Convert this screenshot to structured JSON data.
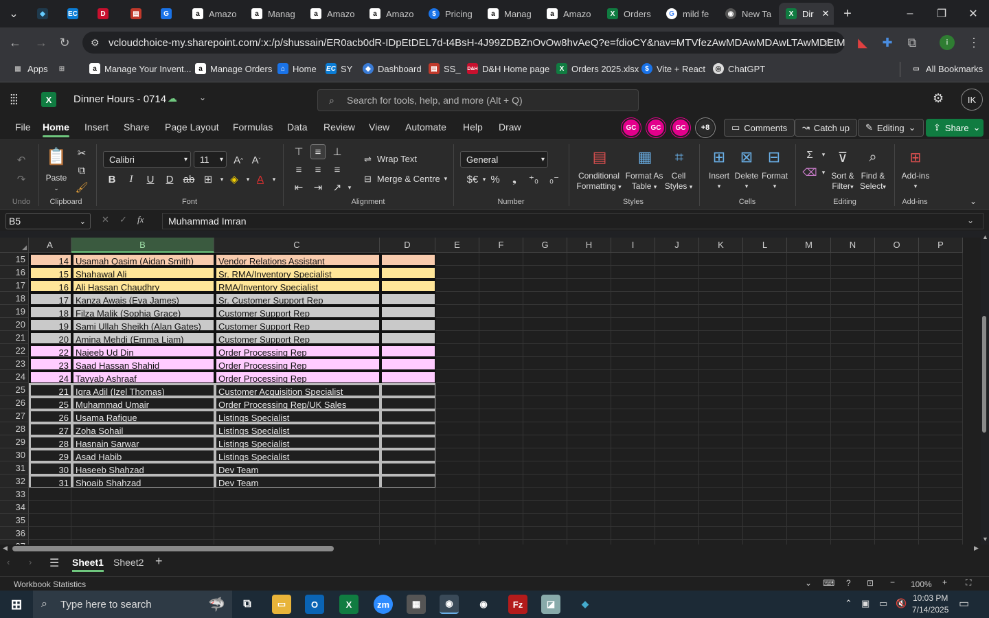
{
  "browser": {
    "tabs": [
      {
        "label": "",
        "icon": "app-icon",
        "active": false
      },
      {
        "label": "",
        "icon": "ec-icon",
        "active": false
      },
      {
        "label": "",
        "icon": "dh-icon",
        "active": false
      },
      {
        "label": "",
        "icon": "box-icon",
        "active": false
      },
      {
        "label": "",
        "icon": "g-icon",
        "active": false
      },
      {
        "label": "Amazo",
        "icon": "amazon-icon",
        "active": false
      },
      {
        "label": "Manag",
        "icon": "amazon-icon",
        "active": false
      },
      {
        "label": "Amazo",
        "icon": "amazon-icon",
        "active": false
      },
      {
        "label": "Amazo",
        "icon": "amazon-icon",
        "active": false
      },
      {
        "label": "Pricing",
        "icon": "dollar-icon",
        "active": false
      },
      {
        "label": "Manag",
        "icon": "amazon-icon",
        "active": false
      },
      {
        "label": "Amazo",
        "icon": "amazon-icon",
        "active": false
      },
      {
        "label": "Orders",
        "icon": "excel-icon",
        "active": false
      },
      {
        "label": "mild fe",
        "icon": "google-icon",
        "active": false
      },
      {
        "label": "New Ta",
        "icon": "chrome-icon",
        "active": false
      },
      {
        "label": "Dir",
        "icon": "excel-icon",
        "active": true
      }
    ],
    "url": "vcloudchoice-my.sharepoint.com/:x:/p/shussain/ER0acb0dR-IDpEtDEL7d-t4BsH-4J99ZDBZnOvOw8hvAeQ?e=fdioCY&nav=MTVfezAwMDAwMDAwLTAwMDEtMDAw...",
    "bookmarks": [
      {
        "label": "Apps"
      },
      {
        "label": ""
      },
      {
        "label": "Manage Your Invent..."
      },
      {
        "label": "Manage Orders"
      },
      {
        "label": "Home"
      },
      {
        "label": "SY"
      },
      {
        "label": "Dashboard"
      },
      {
        "label": "SS_"
      },
      {
        "label": "D&H Home page"
      },
      {
        "label": "Orders 2025.xlsx"
      },
      {
        "label": "Vite + React"
      },
      {
        "label": "ChatGPT"
      }
    ],
    "all_bookmarks": "All Bookmarks"
  },
  "excel": {
    "doc_title": "Dinner Hours - 0714",
    "search_placeholder": "Search for tools, help, and more (Alt + Q)",
    "user_initials": "IK",
    "menus": [
      "File",
      "Home",
      "Insert",
      "Share",
      "Page Layout",
      "Formulas",
      "Data",
      "Review",
      "View",
      "Automate",
      "Help",
      "Draw"
    ],
    "collaborators": [
      "GC",
      "GC",
      "GC"
    ],
    "collab_more": "+8",
    "comments_label": "Comments",
    "catchup_label": "Catch up",
    "editing_label": "Editing",
    "share_label": "Share",
    "ribbon": {
      "undo_group": "Undo",
      "paste": "Paste",
      "clipboard_group": "Clipboard",
      "font_name": "Calibri",
      "font_size": "11",
      "font_group": "Font",
      "wrap_text": "Wrap Text",
      "merge_centre": "Merge & Centre",
      "alignment_group": "Alignment",
      "number_format": "General",
      "number_group": "Number",
      "cond_format_1": "Conditional",
      "cond_format_2": "Formatting",
      "format_table_1": "Format As",
      "format_table_2": "Table",
      "cell_styles_1": "Cell",
      "cell_styles_2": "Styles",
      "styles_group": "Styles",
      "insert": "Insert",
      "delete": "Delete",
      "format": "Format",
      "cells_group": "Cells",
      "sort_1": "Sort &",
      "sort_2": "Filter",
      "find_1": "Find &",
      "find_2": "Select",
      "editing_group": "Editing",
      "addins": "Add-ins",
      "addins_group": "Add-ins"
    },
    "name_box": "B5",
    "formula": "Muhammad Imran",
    "columns": [
      "A",
      "B",
      "C",
      "D",
      "E",
      "F",
      "G",
      "H",
      "I",
      "J",
      "K",
      "L",
      "M",
      "N",
      "O",
      "P"
    ],
    "rows": [
      {
        "row": "15",
        "a": "14",
        "b": "Usamah Qasim (Aidan Smith)",
        "c": "Vendor Relations Assistant",
        "fill": "#f8cbad"
      },
      {
        "row": "16",
        "a": "15",
        "b": "Shahawal Ali",
        "c": "Sr. RMA/Inventory Specialist",
        "fill": "#ffe699"
      },
      {
        "row": "17",
        "a": "16",
        "b": "Ali Hassan Chaudhry",
        "c": "RMA/Inventory Specialist",
        "fill": "#ffe699"
      },
      {
        "row": "18",
        "a": "17",
        "b": "Kanza Awais (Eva James)",
        "c": "Sr. Customer Support Rep",
        "fill": "#c9c9c9"
      },
      {
        "row": "19",
        "a": "18",
        "b": "Filza Malik (Sophia Grace)",
        "c": "Customer Support Rep",
        "fill": "#c9c9c9"
      },
      {
        "row": "20",
        "a": "19",
        "b": "Sami Ullah Sheikh (Alan Gates)",
        "c": "Customer Support Rep",
        "fill": "#c9c9c9"
      },
      {
        "row": "21",
        "a": "20",
        "b": "Amina Mehdi (Emma Liam)",
        "c": "Customer Support Rep",
        "fill": "#c9c9c9"
      },
      {
        "row": "22",
        "a": "22",
        "b": "Najeeb Ud Din",
        "c": "Order Processing Rep",
        "fill": "#ffccff"
      },
      {
        "row": "23",
        "a": "23",
        "b": "Saad Hassan Shahid",
        "c": "Order Processing Rep",
        "fill": "#ffccff"
      },
      {
        "row": "24",
        "a": "24",
        "b": "Tayyab Ashraaf",
        "c": "Order Processing Rep",
        "fill": "#ffccff"
      },
      {
        "row": "25",
        "a": "21",
        "b": "Iqra Adil (Izel Thomas)",
        "c": "Customer Acquisition Specialist",
        "fill": "none"
      },
      {
        "row": "26",
        "a": "25",
        "b": "Muhammad Umair",
        "c": "Order Processing Rep/UK Sales",
        "fill": "none"
      },
      {
        "row": "27",
        "a": "26",
        "b": "Usama Rafique",
        "c": "Listings Specialist",
        "fill": "none"
      },
      {
        "row": "28",
        "a": "27",
        "b": "Zoha Sohail",
        "c": "Listings Specialist",
        "fill": "none"
      },
      {
        "row": "29",
        "a": "28",
        "b": "Hasnain Sarwar",
        "c": "Listings Specialist",
        "fill": "none"
      },
      {
        "row": "30",
        "a": "29",
        "b": "Asad Habib",
        "c": "Listings Specialist",
        "fill": "none"
      },
      {
        "row": "31",
        "a": "30",
        "b": "Haseeb Shahzad",
        "c": "Dev Team",
        "fill": "none"
      },
      {
        "row": "32",
        "a": "31",
        "b": "Shoaib Shahzad",
        "c": "Dev Team",
        "fill": "none"
      },
      {
        "row": "33",
        "a": "",
        "b": "",
        "c": "",
        "fill": "empty"
      },
      {
        "row": "34",
        "a": "",
        "b": "",
        "c": "",
        "fill": "empty"
      },
      {
        "row": "35",
        "a": "",
        "b": "",
        "c": "",
        "fill": "empty"
      },
      {
        "row": "36",
        "a": "",
        "b": "",
        "c": "",
        "fill": "empty"
      },
      {
        "row": "37",
        "a": "",
        "b": "",
        "c": "",
        "fill": "empty"
      }
    ],
    "sheets": [
      "Sheet1",
      "Sheet2"
    ],
    "active_sheet": "Sheet1",
    "status_left": "Workbook Statistics",
    "zoom": "100%"
  },
  "taskbar": {
    "search_placeholder": "Type here to search",
    "time": "10:03 PM",
    "date": "7/14/2025"
  },
  "colors": {
    "accent_green": "#6fc67e",
    "excel_green": "#107c41",
    "share_button": "#107c41",
    "avatar": "#e3008c"
  }
}
